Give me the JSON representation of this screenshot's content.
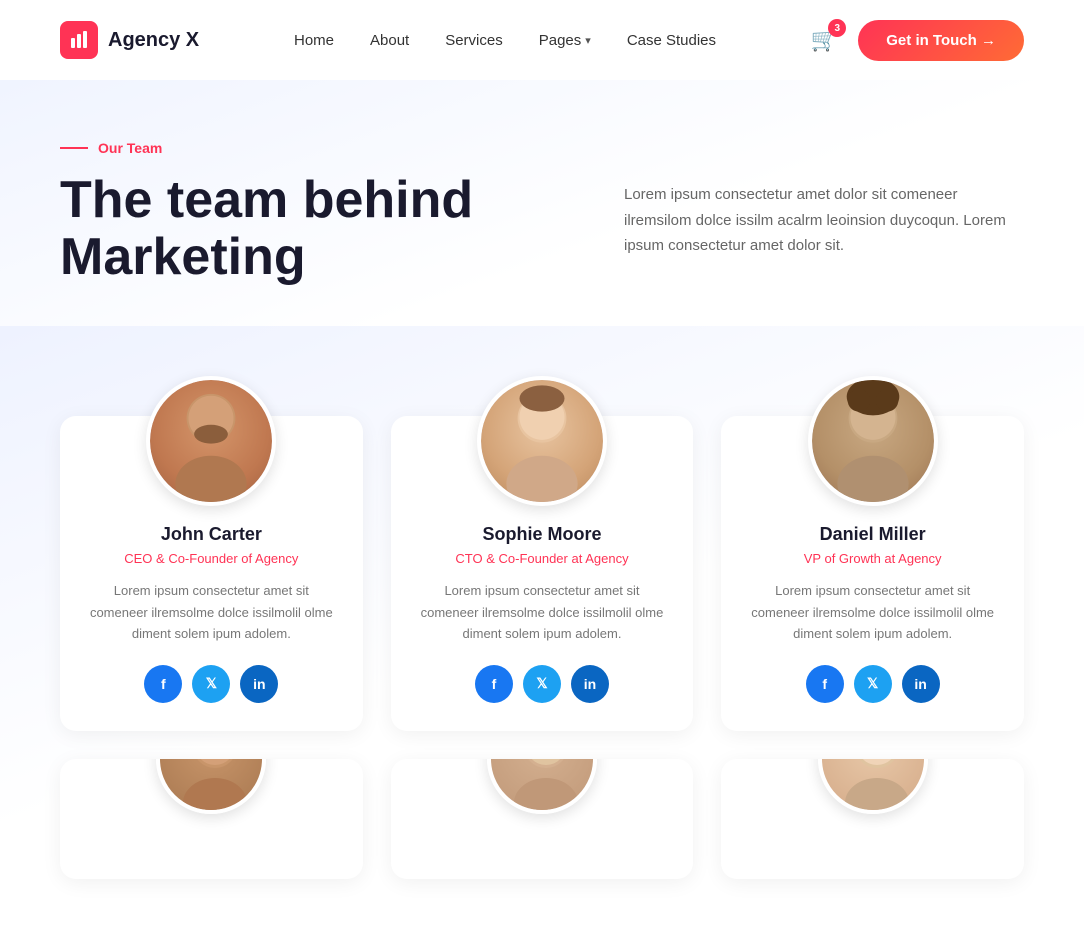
{
  "nav": {
    "logo_icon": "▐▌",
    "logo_text": "Agency X",
    "links": [
      {
        "label": "Home",
        "id": "home"
      },
      {
        "label": "About",
        "id": "about"
      },
      {
        "label": "Services",
        "id": "services"
      },
      {
        "label": "Pages",
        "id": "pages",
        "has_dropdown": true
      },
      {
        "label": "Case Studies",
        "id": "case-studies"
      }
    ],
    "cart_count": "3",
    "cta_label": "Get in Touch →"
  },
  "section": {
    "label": "Our Team",
    "title_line1": "The team behind",
    "title_line2": "Marketing",
    "description": "Lorem ipsum consectetur amet dolor sit comeneer ilremsilom dolce issilm acalrm leoinsion duycoqun. Lorem ipsum consectetur amet dolor sit."
  },
  "team_members": [
    {
      "name": "John Carter",
      "role": "CEO & Co-Founder of Agency",
      "desc": "Lorem ipsum consectetur amet sit comeneer ilremsolme dolce issilmolil olme diment solem ipum adolem.",
      "avatar_class": "avatar-john"
    },
    {
      "name": "Sophie Moore",
      "role": "CTO & Co-Founder at Agency",
      "desc": "Lorem ipsum consectetur amet sit comeneer ilremsolme dolce issilmolil olme diment solem ipum adolem.",
      "avatar_class": "avatar-sophie"
    },
    {
      "name": "Daniel Miller",
      "role": "VP of Growth at Agency",
      "desc": "Lorem ipsum consectetur amet sit comeneer ilremsolme dolce issilmolil olme diment solem ipum adolem.",
      "avatar_class": "avatar-daniel"
    }
  ],
  "social": {
    "facebook": "f",
    "twitter": "t",
    "linkedin": "in"
  }
}
